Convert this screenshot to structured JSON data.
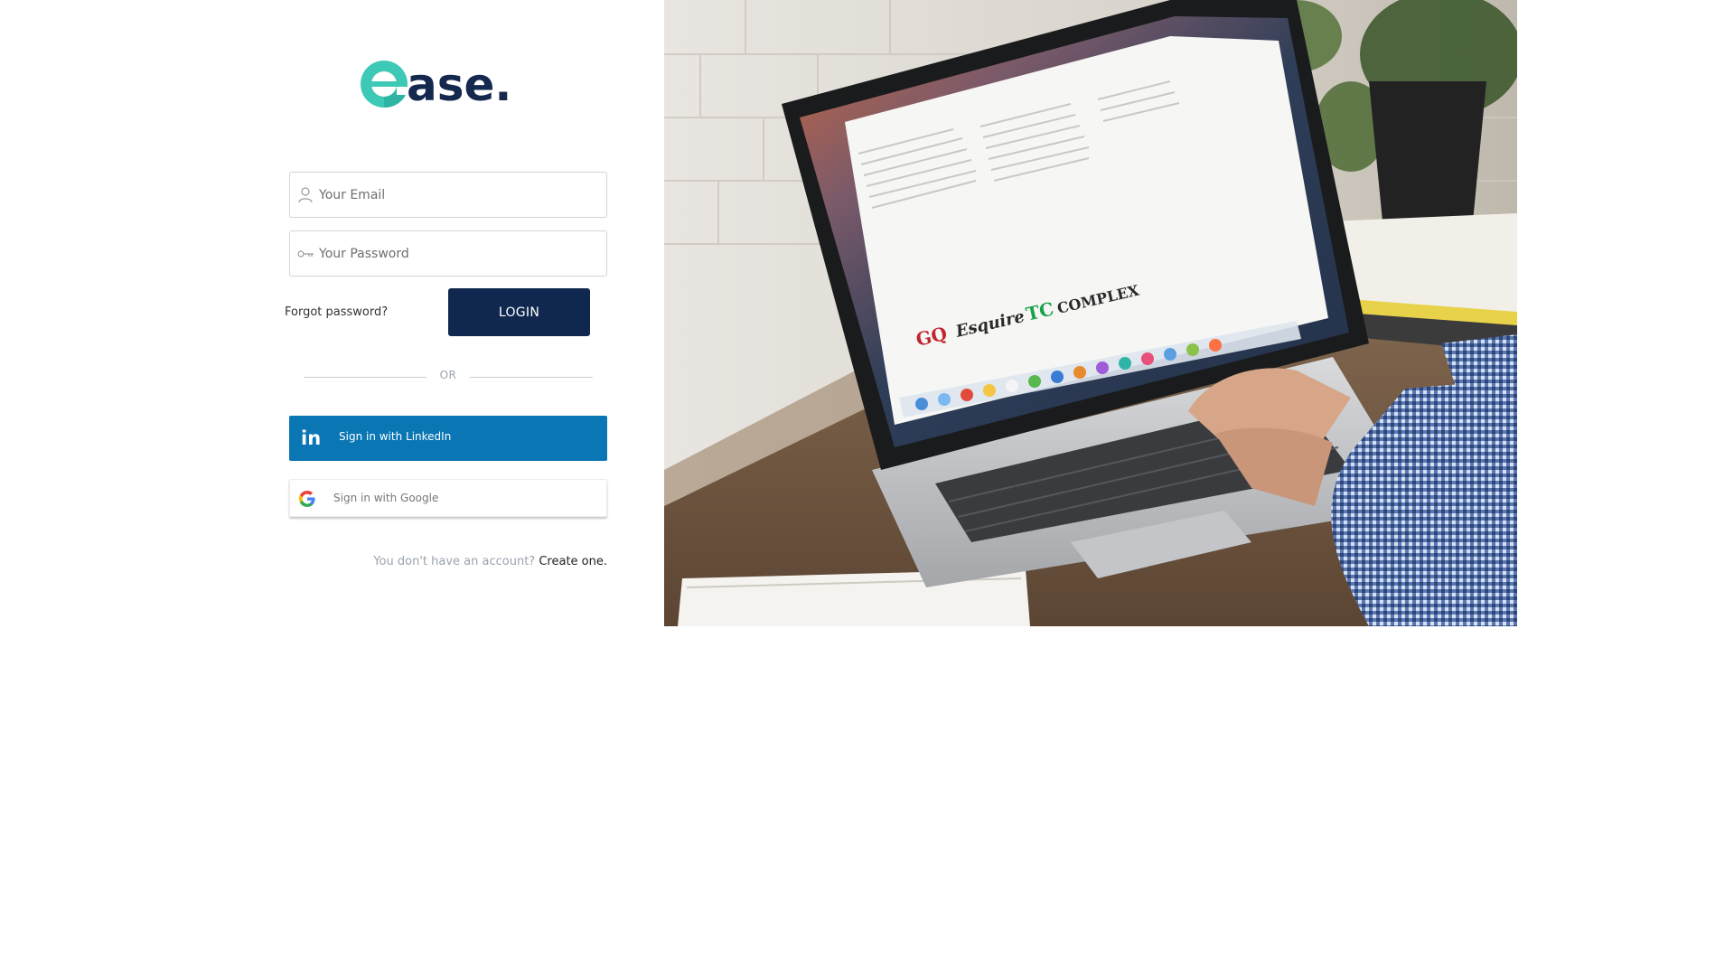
{
  "brand": {
    "logo_text": "ase.",
    "logo_alt": "ease logo",
    "primary_color": "#10284f",
    "accent_color": "#3ec9b6"
  },
  "login_form": {
    "email": {
      "placeholder": "Your Email",
      "value": ""
    },
    "password": {
      "placeholder": "Your Password",
      "value": ""
    },
    "forgot_password_label": "Forgot password?",
    "login_button_label": "LOGIN"
  },
  "divider": {
    "label": "OR"
  },
  "social": {
    "linkedin": {
      "icon_text": "in",
      "label": "Sign in with LinkedIn",
      "color": "#0a76b4"
    },
    "google": {
      "label": "Sign in with Google"
    }
  },
  "signup": {
    "prompt": "You don't have an account?",
    "link_label": "Create one."
  },
  "hero": {
    "description": "photo of hands typing on a laptop showing press logos",
    "screen_logos": [
      "GQ",
      "Esquire",
      "TC",
      "COMPLEX"
    ]
  }
}
